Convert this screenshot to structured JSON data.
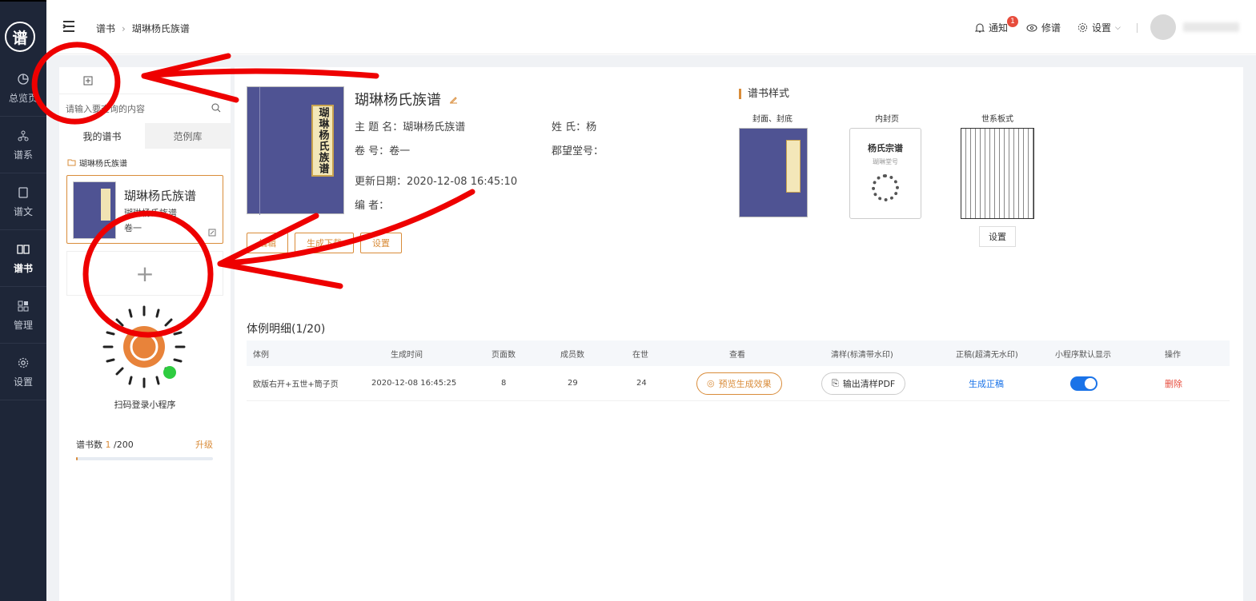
{
  "sidebar": {
    "logo": "谱",
    "items": [
      {
        "label": "总览页",
        "icon": "pie-chart-icon"
      },
      {
        "label": "谱系",
        "icon": "tree-icon"
      },
      {
        "label": "谱文",
        "icon": "document-icon"
      },
      {
        "label": "谱书",
        "icon": "book-icon"
      },
      {
        "label": "管理",
        "icon": "grid-icon"
      },
      {
        "label": "设置",
        "icon": "gear-icon"
      }
    ],
    "active": "谱书"
  },
  "header": {
    "breadcrumb": [
      "谱书",
      "瑚琳杨氏族谱"
    ],
    "notify": "通知",
    "notify_badge": "1",
    "preview": "修谱",
    "settings": "设置"
  },
  "left": {
    "search_placeholder": "请输入要查询的内容",
    "tabs": [
      "我的谱书",
      "范例库"
    ],
    "folder": "瑚琳杨氏族谱",
    "book": {
      "title": "瑚琳杨氏族谱",
      "subtitle": "瑚琳杨氏族谱",
      "volume": "卷一"
    },
    "qr_caption": "扫码登录小程序",
    "count_label": "谱书数",
    "count_value": "1",
    "count_total": "/200",
    "upgrade": "升级",
    "usage_fraction": 0.005
  },
  "book": {
    "title": "瑚琳杨氏族谱",
    "cover_label": "瑚琳杨氏族谱",
    "subject_label": "主  题  名：",
    "subject": "瑚琳杨氏族谱",
    "surname_label": "姓      氏：",
    "surname": "杨",
    "volume_label": "卷      号：",
    "volume": "卷一",
    "hall_label": "郡望堂号：",
    "hall": "",
    "updated_label": "更新日期：",
    "updated": "2020-12-08 16:45:10",
    "editor_label": "编      者：",
    "editor": "",
    "buttons": [
      "编辑",
      "生成下载",
      "设置"
    ]
  },
  "styles": {
    "heading": "谱书样式",
    "items": [
      "封面、封底",
      "内封页",
      "世系板式"
    ],
    "inner_title": "杨氏宗谱",
    "inner_sub": "瑚琳堂号",
    "settings_btn": "设置"
  },
  "table": {
    "title": "体例明细(1/20)",
    "headers": [
      "体例",
      "生成时间",
      "页面数",
      "成员数",
      "在世",
      "查看",
      "清样(标清带水印)",
      "正稿(超清无水印)",
      "小程序默认显示",
      "操作"
    ],
    "rows": [
      {
        "style": "欧版右开+五世+筒子页",
        "time": "2020-12-08 16:45:25",
        "pages": "8",
        "members": "29",
        "alive": "24",
        "view": "预览生成效果",
        "proof": "输出清样PDF",
        "final": "生成正稿",
        "show": true,
        "op": "删除"
      }
    ]
  }
}
